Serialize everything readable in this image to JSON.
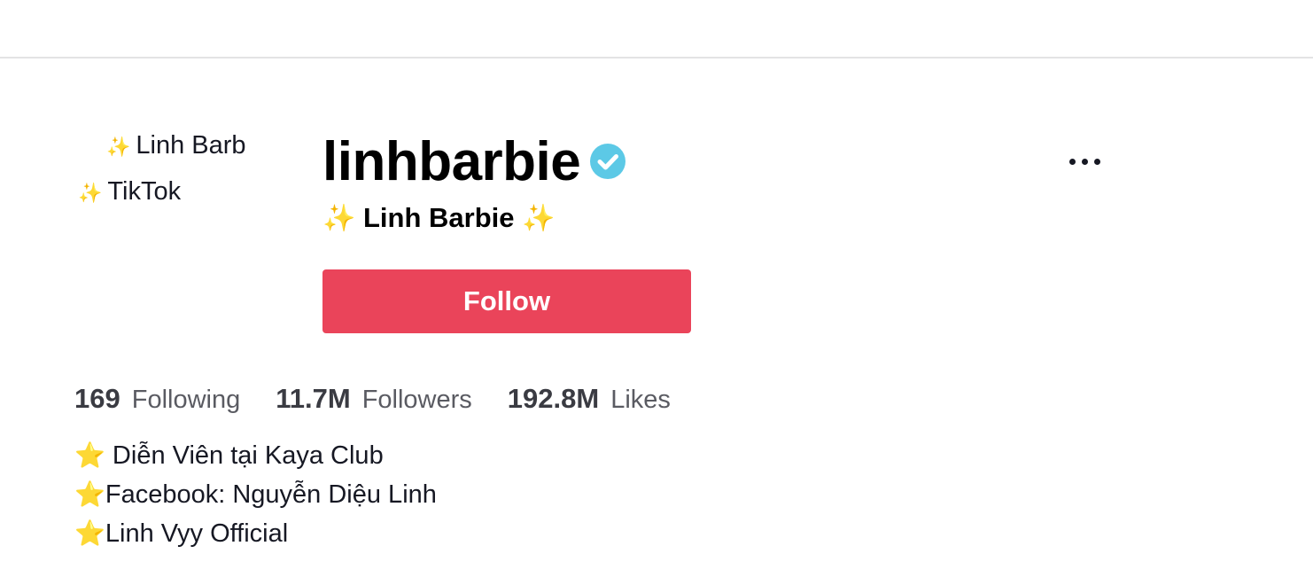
{
  "profile": {
    "avatar_alt_line1": "Linh Barb",
    "avatar_alt_line2": "TikTok",
    "username": "linhbarbie",
    "nickname": "Linh Barbie",
    "sparkle": "✨",
    "follow_label": "Follow"
  },
  "stats": [
    {
      "value": "169",
      "label": "Following"
    },
    {
      "value": "11.7M",
      "label": "Followers"
    },
    {
      "value": "192.8M",
      "label": "Likes"
    }
  ],
  "bio": {
    "star": "⭐",
    "lines": [
      " Diễn Viên tại Kaya Club",
      "Facebook: Nguyễn Diệu Linh",
      "Linh Vyy Official"
    ]
  },
  "icons": {
    "verified": "verified-badge-icon",
    "more": "more-options-icon"
  },
  "colors": {
    "follow_button": "#ea445a",
    "verified_badge": "#20d5ec",
    "sparkle": "#f2b632"
  }
}
